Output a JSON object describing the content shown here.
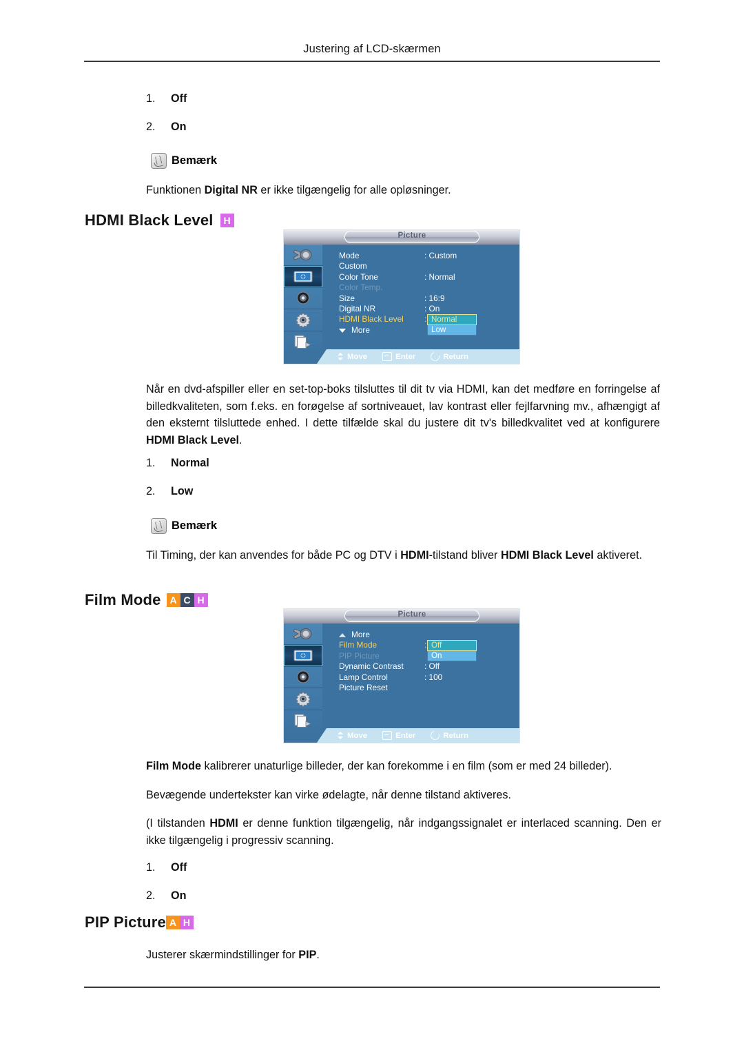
{
  "page": {
    "running_header": "Justering af LCD-skærmen"
  },
  "top_list": {
    "items": [
      {
        "num": "1.",
        "label": "Off"
      },
      {
        "num": "2.",
        "label": "On"
      }
    ]
  },
  "note1": {
    "title": "Bemærk",
    "icon": "note-hand-icon",
    "body_pre": "Funktionen ",
    "body_bold": "Digital NR",
    "body_post": " er ikke tilgængelig for alle opløsninger."
  },
  "section_hdmi": {
    "heading": "HDMI Black Level",
    "badges": [
      {
        "letter": "H",
        "color": "#d66ae8"
      }
    ],
    "osd": {
      "title": "Picture",
      "sidebar": [
        {
          "name": "input-source-icon",
          "active": false
        },
        {
          "name": "picture-icon",
          "active": true
        },
        {
          "name": "sound-speaker-icon",
          "active": false
        },
        {
          "name": "setup-gear-icon",
          "active": false
        },
        {
          "name": "multi-control-icon",
          "active": false
        }
      ],
      "rows": [
        {
          "label": "Mode",
          "value": ": Custom",
          "state": "normal"
        },
        {
          "label": "Custom",
          "value": "",
          "state": "normal"
        },
        {
          "label": "Color Tone",
          "value": ": Normal",
          "state": "normal"
        },
        {
          "label": "Color Temp.",
          "value": "",
          "state": "disabled"
        },
        {
          "label": "Size",
          "value": ": 16:9",
          "state": "normal"
        },
        {
          "label": "Digital NR",
          "value": ": On",
          "state": "normal"
        },
        {
          "label": "HDMI Black Level",
          "value": ":",
          "state": "active"
        },
        {
          "label": "More",
          "value": "",
          "state": "normal",
          "arrow": "down"
        }
      ],
      "dropdown": {
        "selected": "Normal",
        "options": [
          "Normal",
          "Low"
        ]
      },
      "footer": [
        {
          "icon": "move-icon",
          "label": "Move"
        },
        {
          "icon": "enter-icon",
          "label": "Enter"
        },
        {
          "icon": "return-icon",
          "label": "Return"
        }
      ]
    },
    "paragraph_1": "Når en dvd-afspiller eller en set-top-boks tilsluttes til dit tv via HDMI, kan det medføre en forringelse af billedkvaliteten, som f.eks. en forøgelse af sortniveauet, lav kontrast eller fejlfarvning mv., afhængigt af den eksternt tilsluttede enhed. I dette tilfælde skal du justere dit tv's billedkvalitet ved at konfigurere ",
    "paragraph_1_bold": "HDMI Black Level",
    "paragraph_1_end": ".",
    "list": [
      {
        "num": "1.",
        "label": "Normal"
      },
      {
        "num": "2.",
        "label": "Low"
      }
    ],
    "note": {
      "title": "Bemærk",
      "pre": "Til Timing, der kan anvendes for både PC og DTV i ",
      "bold1": "HDMI",
      "mid": "-tilstand bliver ",
      "bold2": "HDMI Black Level",
      "post": " aktiveret."
    }
  },
  "section_film": {
    "heading": "Film Mode",
    "badges": [
      {
        "letter": "A",
        "color": "#f7941e"
      },
      {
        "letter": "C",
        "color": "#3d4a63"
      },
      {
        "letter": "H",
        "color": "#d66ae8"
      }
    ],
    "osd": {
      "title": "Picture",
      "sidebar": [
        {
          "name": "input-source-icon",
          "active": false
        },
        {
          "name": "picture-icon",
          "active": true
        },
        {
          "name": "sound-speaker-icon",
          "active": false
        },
        {
          "name": "setup-gear-icon",
          "active": false
        },
        {
          "name": "multi-control-icon",
          "active": false
        }
      ],
      "rows": [
        {
          "label": "More",
          "value": "",
          "state": "normal",
          "arrow": "up"
        },
        {
          "label": "Film Mode",
          "value": ":",
          "state": "active"
        },
        {
          "label": "PIP Picture",
          "value": "",
          "state": "disabled"
        },
        {
          "label": "Dynamic Contrast",
          "value": ": Off",
          "state": "normal"
        },
        {
          "label": "Lamp Control",
          "value": ": 100",
          "state": "normal"
        },
        {
          "label": "Picture Reset",
          "value": "",
          "state": "normal"
        }
      ],
      "dropdown": {
        "selected": "Off",
        "options": [
          "Off",
          "On"
        ]
      },
      "footer": [
        {
          "icon": "move-icon",
          "label": "Move"
        },
        {
          "icon": "enter-icon",
          "label": "Enter"
        },
        {
          "icon": "return-icon",
          "label": "Return"
        }
      ]
    },
    "paragraph_1_bold": "Film Mode",
    "paragraph_1": " kalibrerer unaturlige billeder, der kan forekomme i en film (som er med 24 billeder).",
    "paragraph_2": "Bevægende undertekster kan virke ødelagte, når denne tilstand aktiveres.",
    "paragraph_3_pre": "(I tilstanden ",
    "paragraph_3_bold": "HDMI",
    "paragraph_3_post": " er denne funktion tilgængelig, når indgangssignalet er interlaced scanning. Den er ikke tilgængelig i progressiv scanning.",
    "list": [
      {
        "num": "1.",
        "label": "Off"
      },
      {
        "num": "2.",
        "label": "On"
      }
    ]
  },
  "section_pip": {
    "heading": "PIP Picture",
    "badges": [
      {
        "letter": "A",
        "color": "#f7941e"
      },
      {
        "letter": "H",
        "color": "#d66ae8"
      }
    ],
    "paragraph_pre": "Justerer skærmindstillinger for ",
    "paragraph_bold": "PIP",
    "paragraph_post": "."
  }
}
